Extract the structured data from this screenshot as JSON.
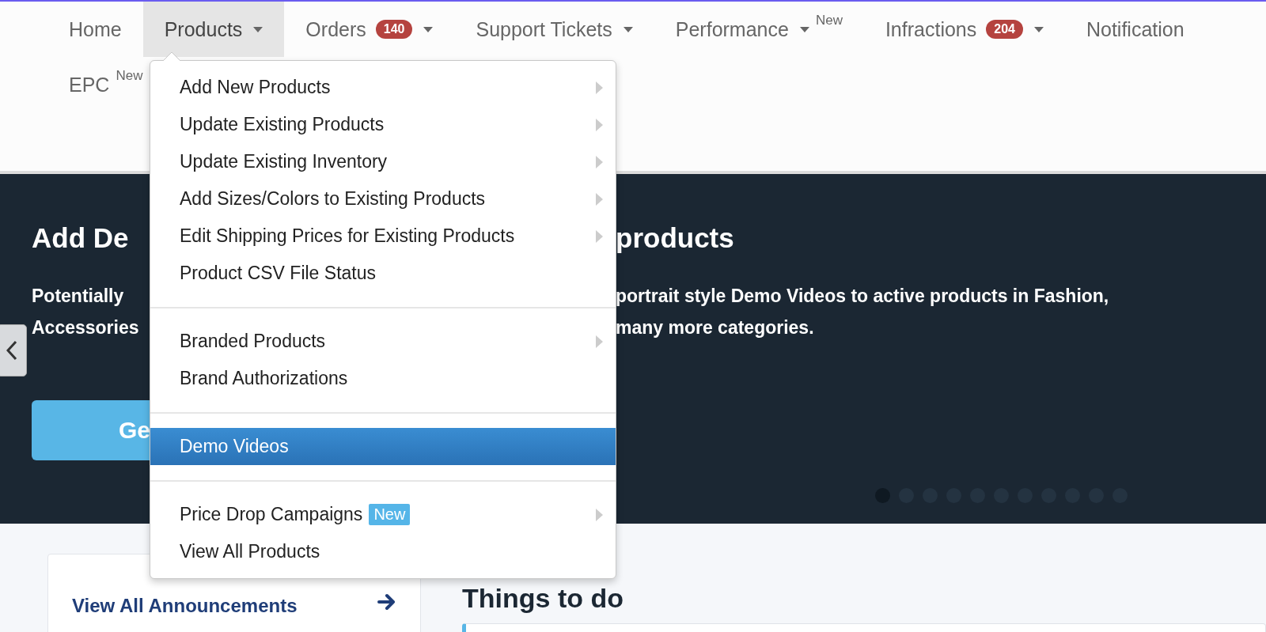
{
  "nav": {
    "rows": [
      [
        {
          "label": "Home",
          "caret": false,
          "selected": false
        },
        {
          "label": "Products",
          "caret": true,
          "selected": true
        },
        {
          "label": "Orders",
          "badge": "140",
          "caret": true,
          "selected": false
        },
        {
          "label": "Support Tickets",
          "caret": true,
          "selected": false
        },
        {
          "label": "Performance",
          "caret": true,
          "new_tag": "New",
          "selected": false
        },
        {
          "label": "Infractions",
          "badge": "204",
          "caret": true,
          "selected": false
        },
        {
          "label": "Notification",
          "caret": false,
          "selected": false
        }
      ],
      [
        {
          "label": "EPC",
          "caret": false,
          "new_tag": "New",
          "selected": false
        }
      ]
    ]
  },
  "dropdown": {
    "groups": [
      [
        {
          "label": "Add New Products",
          "submenu": true,
          "selected": false
        },
        {
          "label": "Update Existing Products",
          "submenu": true,
          "selected": false
        },
        {
          "label": "Update Existing Inventory",
          "submenu": true,
          "selected": false
        },
        {
          "label": "Add Sizes/Colors to Existing Products",
          "submenu": true,
          "selected": false
        },
        {
          "label": "Edit Shipping Prices for Existing Products",
          "submenu": true,
          "selected": false
        },
        {
          "label": "Product CSV File Status",
          "submenu": false,
          "selected": false
        }
      ],
      [
        {
          "label": "Branded Products",
          "submenu": true,
          "selected": false
        },
        {
          "label": "Brand Authorizations",
          "submenu": false,
          "selected": false
        }
      ],
      [
        {
          "label": "Demo Videos",
          "submenu": false,
          "selected": true
        }
      ],
      [
        {
          "label": "Price Drop Campaigns",
          "tag": "New",
          "submenu": true,
          "selected": false
        },
        {
          "label": "View All Products",
          "submenu": false,
          "selected": false
        }
      ]
    ]
  },
  "banner": {
    "heading_left": "Add De",
    "heading_right": "products",
    "text_left": [
      "Potentially",
      "Accessories"
    ],
    "text_right": [
      "portrait style Demo Videos to active products in Fashion,",
      "many more categories."
    ],
    "button": "Ge",
    "slides": [
      {
        "selected": true
      },
      {
        "selected": false
      },
      {
        "selected": false
      },
      {
        "selected": false
      },
      {
        "selected": false
      },
      {
        "selected": false
      },
      {
        "selected": false
      },
      {
        "selected": false
      },
      {
        "selected": false
      },
      {
        "selected": false
      },
      {
        "selected": false
      }
    ]
  },
  "announcements": {
    "link": "View All Announcements"
  },
  "things_to_do": {
    "title": "Things to do"
  }
}
